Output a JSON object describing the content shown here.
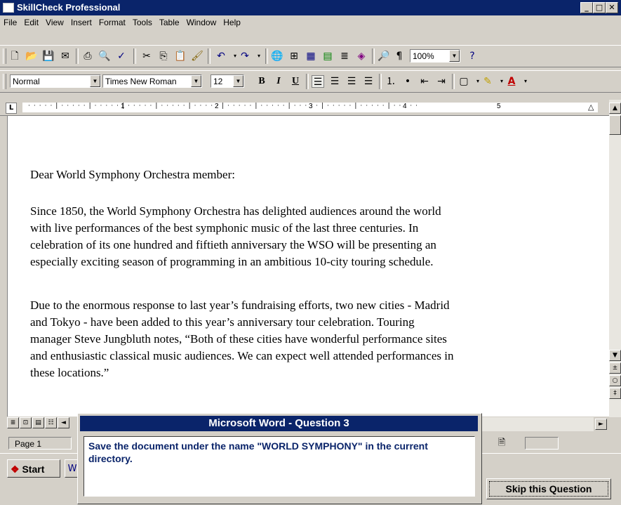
{
  "window": {
    "title": "SkillCheck Professional"
  },
  "menu": [
    "File",
    "Edit",
    "View",
    "Insert",
    "Format",
    "Tools",
    "Table",
    "Window",
    "Help"
  ],
  "toolbar": {
    "zoom": "100%"
  },
  "format": {
    "style": "Normal",
    "font": "Times New Roman",
    "size": "12",
    "bold": "B",
    "italic": "I",
    "underline": "U"
  },
  "ruler": {
    "marks": [
      "1",
      "2",
      "3",
      "4",
      "5"
    ]
  },
  "document": {
    "p1": "Dear World Symphony Orchestra member:",
    "p2": [
      "Since 1850, the World Symphony Orchestra has delighted audiences around the world",
      "with live performances of the best symphonic music of the last three centuries.  In",
      "celebration of its one hundred and fiftieth anniversary the WSO will be presenting an",
      "especially exciting season of programming in an ambitious 10-city touring schedule."
    ],
    "p3": [
      "Due to the enormous response to last year’s fundraising efforts, two new cities - Madrid",
      "and Tokyo - have been added to this year’s anniversary tour celebration.  Touring",
      "manager Steve Jungbluth notes,  “Both of these cities have wonderful performance sites",
      "and enthusiastic classical music audiences.  We can expect well attended performances in",
      "these locations.”"
    ]
  },
  "status": {
    "page": "Page  1"
  },
  "taskbar": {
    "start": "Start"
  },
  "dialog": {
    "title": "Microsoft Word - Question 3",
    "body": "Save the document under the name \"WORLD SYMPHONY\" in the current directory.",
    "skip": "Skip this Question"
  }
}
